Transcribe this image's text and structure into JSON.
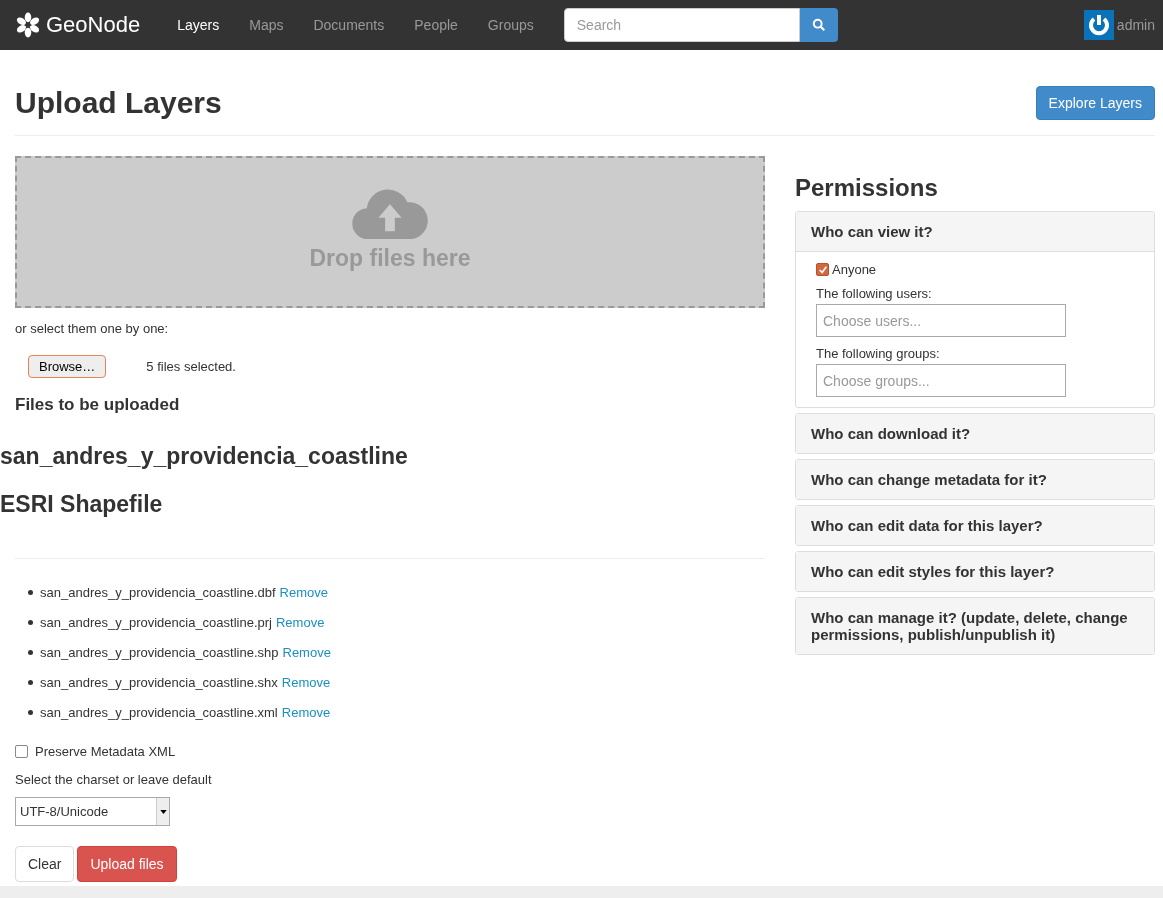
{
  "navbar": {
    "brand": "GeoNode",
    "items": [
      {
        "label": "Layers",
        "selected": true
      },
      {
        "label": "Maps",
        "selected": false
      },
      {
        "label": "Documents",
        "selected": false
      },
      {
        "label": "People",
        "selected": false
      },
      {
        "label": "Groups",
        "selected": false
      }
    ],
    "search": {
      "placeholder": "Search"
    },
    "user": "admin"
  },
  "page": {
    "title": "Upload Layers",
    "explore_button": "Explore Layers"
  },
  "upload": {
    "dropzone_text": "Drop files here",
    "select_hint": "or select them one by one:",
    "browse_button": "Browse…",
    "file_status": "5 files selected.",
    "files_heading": "Files to be uploaded",
    "layer_name": "san_andres_y_providencia_coastline",
    "layer_type": "ESRI Shapefile",
    "files": [
      {
        "name": "san_andres_y_providencia_coastline.dbf",
        "action": "Remove"
      },
      {
        "name": "san_andres_y_providencia_coastline.prj",
        "action": "Remove"
      },
      {
        "name": "san_andres_y_providencia_coastline.shp",
        "action": "Remove"
      },
      {
        "name": "san_andres_y_providencia_coastline.shx",
        "action": "Remove"
      },
      {
        "name": "san_andres_y_providencia_coastline.xml",
        "action": "Remove"
      }
    ],
    "preserve_metadata": {
      "label": "Preserve Metadata XML",
      "checked": false
    },
    "charset_label": "Select the charset or leave default",
    "charset": {
      "value": "UTF-8/Unicode"
    },
    "buttons": {
      "clear": "Clear",
      "upload": "Upload files"
    }
  },
  "permissions": {
    "title": "Permissions",
    "panels": [
      {
        "title": "Who can view it?",
        "expanded": true,
        "anyone": {
          "label": "Anyone",
          "checked": true
        },
        "users_label": "The following users:",
        "users_placeholder": "Choose users...",
        "groups_label": "The following groups:",
        "groups_placeholder": "Choose groups..."
      },
      {
        "title": "Who can download it?",
        "expanded": false
      },
      {
        "title": "Who can change metadata for it?",
        "expanded": false
      },
      {
        "title": "Who can edit data for this layer?",
        "expanded": false
      },
      {
        "title": "Who can edit styles for this layer?",
        "expanded": false
      },
      {
        "title": "Who can manage it? (update, delete, change permissions, publish/unpublish it)",
        "expanded": false
      }
    ]
  }
}
